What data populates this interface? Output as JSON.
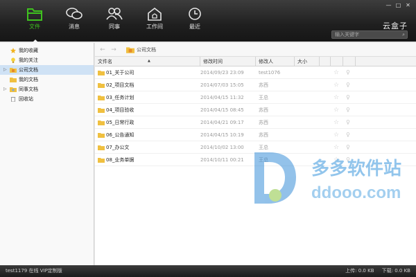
{
  "window": {
    "brand": "云盒子",
    "min_label": "—",
    "max_label": "□",
    "close_label": "✕"
  },
  "nav": [
    {
      "label": "文件",
      "icon": "folder-icon",
      "active": true
    },
    {
      "label": "消息",
      "icon": "chat-icon",
      "active": false
    },
    {
      "label": "同事",
      "icon": "users-icon",
      "active": false
    },
    {
      "label": "工作间",
      "icon": "workspace-icon",
      "active": false
    },
    {
      "label": "最近",
      "icon": "clock-icon",
      "active": false
    }
  ],
  "search": {
    "placeholder": "输入关键字"
  },
  "sidebar": {
    "items": [
      {
        "label": "我的收藏",
        "icon": "star-icon"
      },
      {
        "label": "我的关注",
        "icon": "bulb-icon"
      },
      {
        "label": "公司文档",
        "icon": "company-folder-icon",
        "expandable": true,
        "selected": true
      },
      {
        "label": "我的文档",
        "icon": "folder-icon"
      },
      {
        "label": "同事文档",
        "icon": "folder-icon",
        "expandable": true
      },
      {
        "label": "回收站",
        "icon": "trash-icon"
      }
    ]
  },
  "path": {
    "current": "公司文档"
  },
  "table": {
    "headers": {
      "name": "文件名",
      "time": "修改时间",
      "editor": "修改人",
      "size": "大小"
    },
    "rows": [
      {
        "name": "01_关于公司",
        "time": "2014/09/23 23:09",
        "editor": "test1076"
      },
      {
        "name": "02_项目文档",
        "time": "2014/07/03 15:05",
        "editor": "苏西"
      },
      {
        "name": "03_任务计划",
        "time": "2014/04/15 11:32",
        "editor": "王总"
      },
      {
        "name": "04_项目验收",
        "time": "2014/04/15 08:45",
        "editor": "苏西"
      },
      {
        "name": "05_日常行政",
        "time": "2014/04/21 09:17",
        "editor": "苏西"
      },
      {
        "name": "06_公告通知",
        "time": "2014/04/15 10:19",
        "editor": "苏西"
      },
      {
        "name": "07_办公文",
        "time": "2014/10/02 13:00",
        "editor": "王总"
      },
      {
        "name": "08_业务单据",
        "time": "2014/10/11 00:21",
        "editor": "王总"
      }
    ]
  },
  "watermark": {
    "cn": "多多软件站",
    "en": "ddooo.com"
  },
  "status": {
    "user": "test1179",
    "state": "在线",
    "plan": "VIP定制版",
    "upload": "上传: 0.0 KB",
    "download": "下载: 0.0 KB"
  },
  "colors": {
    "accent": "#3fc21f",
    "topbar": "#1f1f1f",
    "selected_row": "#cfe2f5",
    "folder": "#f0c040"
  }
}
